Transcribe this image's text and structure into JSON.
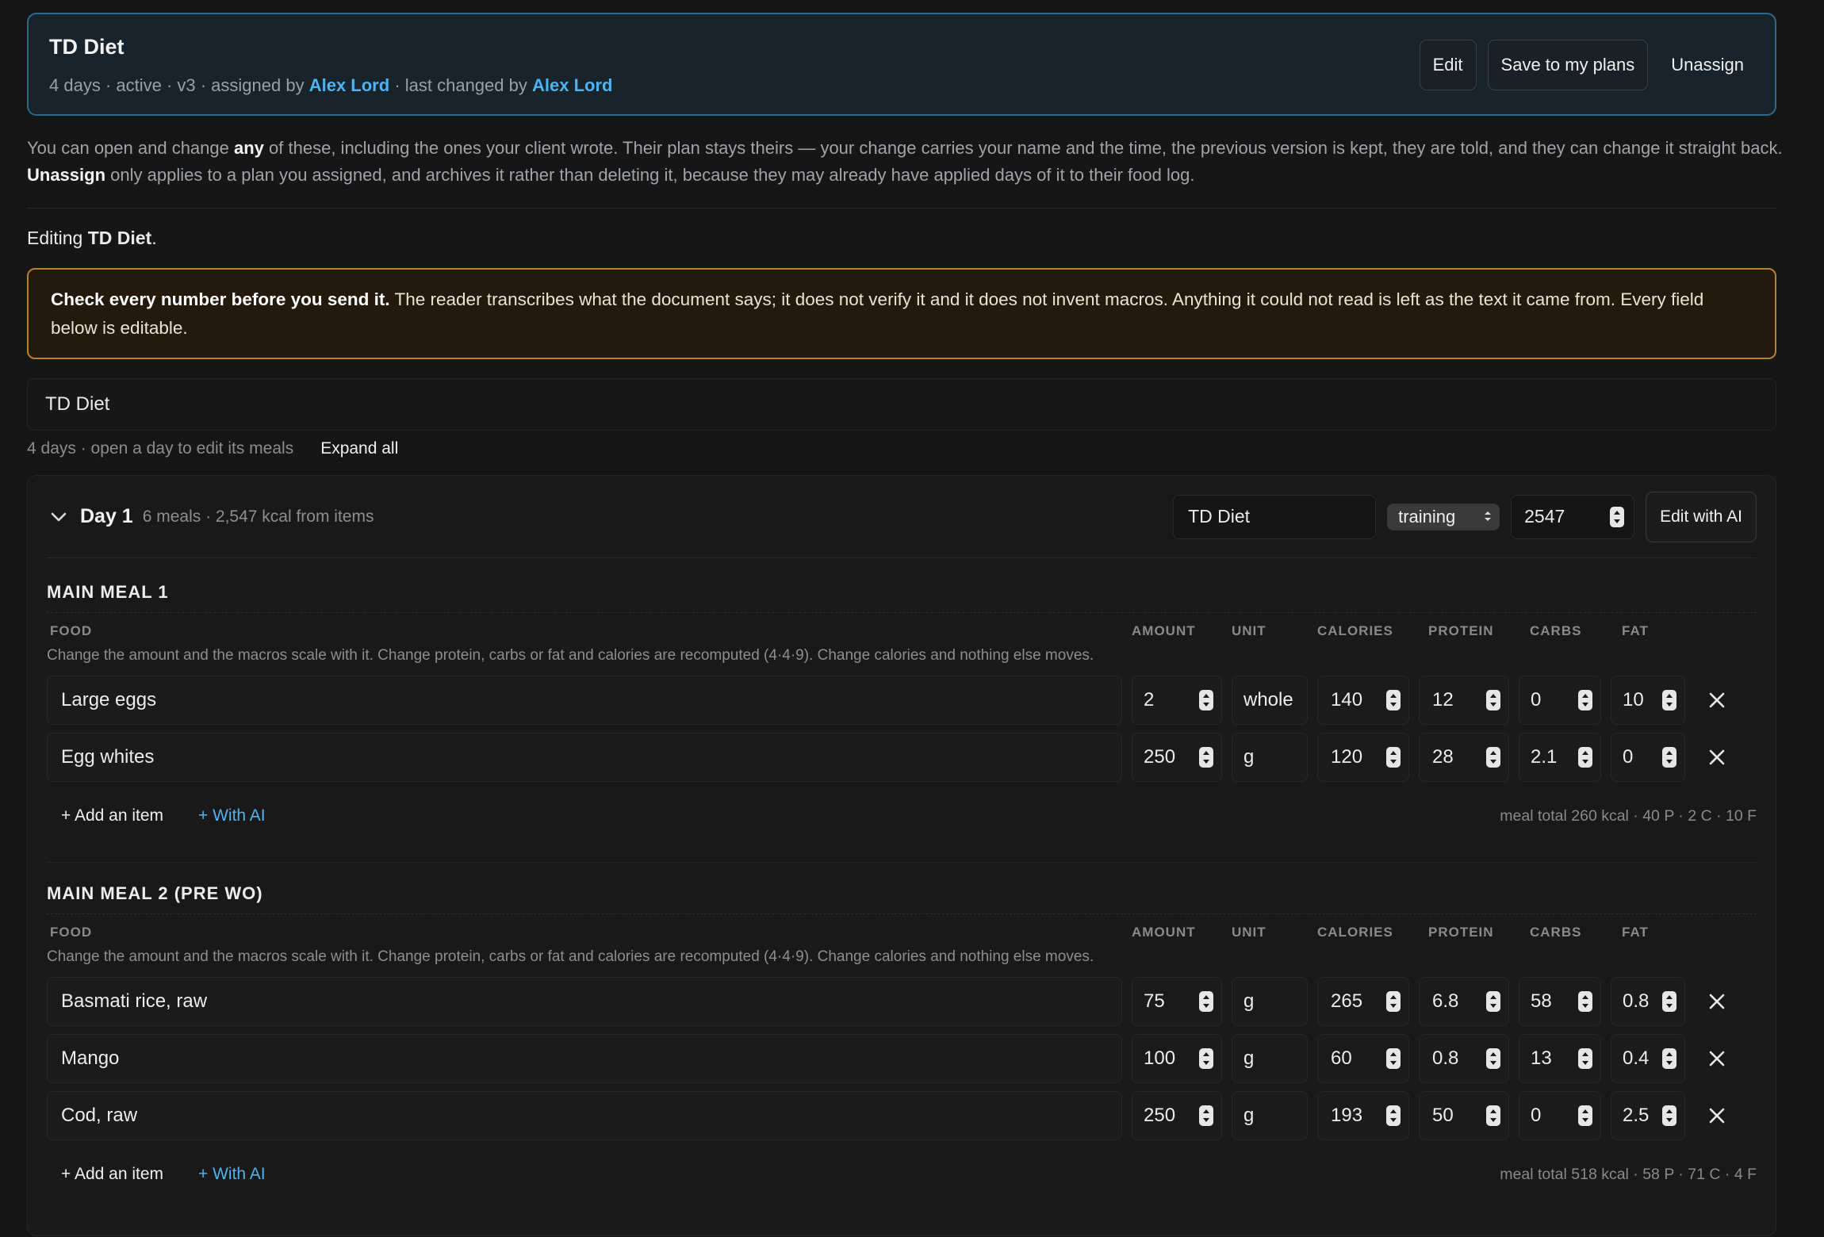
{
  "plan": {
    "title": "TD Diet",
    "meta_prefix": "4 days · active · v3 · assigned by",
    "assigned_by": "Alex Lord",
    "meta_mid": "· last changed by",
    "changed_by": "Alex Lord",
    "actions": {
      "edit": "Edit",
      "save": "Save to my plans",
      "unassign": "Unassign"
    }
  },
  "info": {
    "p1": "You can open and change",
    "b1": "any",
    "p2": "of these, including the ones your client wrote. Their plan stays theirs — your change carries your name and the time, the previous version is kept, they are told, and they can change it straight back.",
    "b2": "Unassign",
    "p3": "only applies to a plan you assigned, and archives it rather than deleting it, because they may already have applied days of it to their food log."
  },
  "editing": {
    "prefix": "Editing",
    "name": "TD Diet",
    "suffix": "."
  },
  "warning": {
    "bold": "Check every number before you send it.",
    "text": "The reader transcribes what the document says; it does not verify it and it does not invent macros. Anything it could not read is left as the text it came from. Every field below is editable."
  },
  "plan_name_value": "TD Diet",
  "days_info": "4 days · open a day to edit its meals",
  "expand_all": "Expand all",
  "day": {
    "title": "Day 1",
    "meta": "6 meals · 2,547 kcal from items",
    "name_value": "TD Diet",
    "type_value": "training",
    "kcal_value": "2547",
    "edit_ai": "Edit with AI"
  },
  "columns": {
    "food": "FOOD",
    "amount": "AMOUNT",
    "unit": "UNIT",
    "calories": "CALORIES",
    "protein": "PROTEIN",
    "carbs": "CARBS",
    "fat": "FAT"
  },
  "hint": "Change the amount and the macros scale with it. Change protein, carbs or fat and calories are recomputed (4·4·9). Change calories and nothing else moves.",
  "footer": {
    "add_item": "+ Add an item",
    "with_ai": "+ With AI"
  },
  "meals": [
    {
      "title": "MAIN MEAL 1",
      "items": [
        {
          "food": "Large eggs",
          "amount": "2",
          "unit": "whole",
          "calories": "140",
          "protein": "12",
          "carbs": "0",
          "fat": "10"
        },
        {
          "food": "Egg whites",
          "amount": "250",
          "unit": "g",
          "calories": "120",
          "protein": "28",
          "carbs": "2.1",
          "fat": "0"
        }
      ],
      "total": "meal total 260 kcal · 40 P · 2 C · 10 F"
    },
    {
      "title": "MAIN MEAL 2 (PRE WO)",
      "items": [
        {
          "food": "Basmati rice, raw",
          "amount": "75",
          "unit": "g",
          "calories": "265",
          "protein": "6.8",
          "carbs": "58",
          "fat": "0.8"
        },
        {
          "food": "Mango",
          "amount": "100",
          "unit": "g",
          "calories": "60",
          "protein": "0.8",
          "carbs": "13",
          "fat": "0.4"
        },
        {
          "food": "Cod, raw",
          "amount": "250",
          "unit": "g",
          "calories": "193",
          "protein": "50",
          "carbs": "0",
          "fat": "2.5"
        }
      ],
      "total": "meal total 518 kcal · 58 P · 71 C · 4 F"
    }
  ],
  "icons": {
    "chevron": "chevron-down-icon",
    "delete": "close-icon",
    "spinner": "stepper-icon",
    "select": "select-arrows-icon"
  },
  "colors": {
    "accent": "#4fb3f0",
    "warning_border": "#b8812e",
    "header_border": "#2b6a8c"
  }
}
